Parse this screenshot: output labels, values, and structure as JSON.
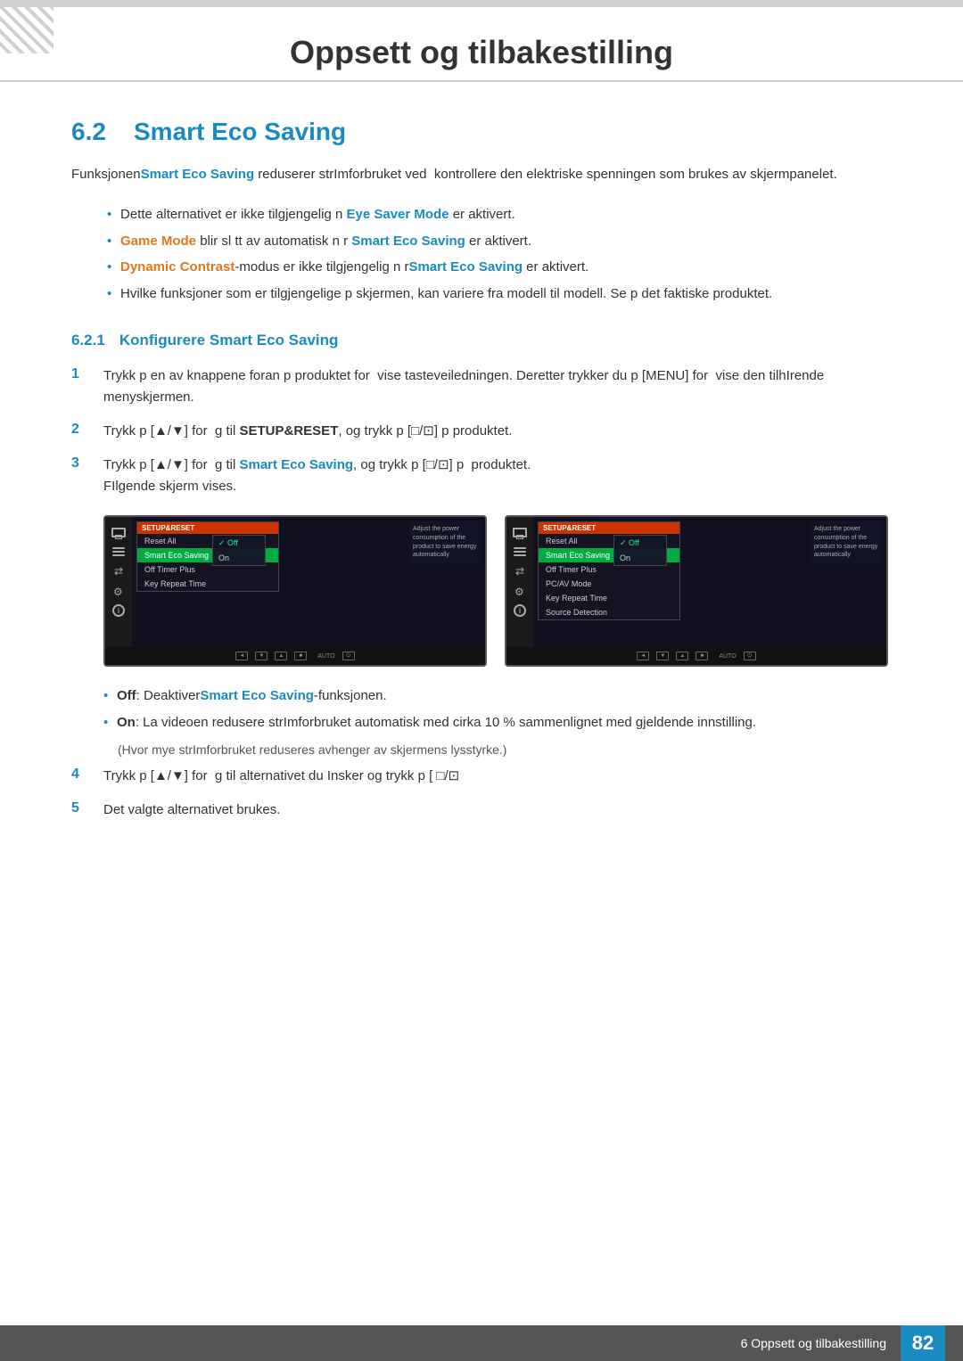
{
  "page": {
    "title": "Oppsett og tilbakestilling",
    "section_number": "6.2",
    "section_title": "Smart Eco Saving",
    "subsection_number": "6.2.1",
    "subsection_title": "Konfigurere Smart Eco Saving",
    "footer_text": "6 Oppsett og tilbakestilling",
    "footer_page": "82"
  },
  "intro_text": "FunksjonenSmart Eco Saving reduserer strImforbruket ved  kontrollere den elektriske spenningen som brukes av skjermpanelet.",
  "bullet_items": [
    {
      "text": "Dette alternativet er ikke tilgjengelig n Eye Saver Mode er aktivert.",
      "highlight": "Eye Saver Mode"
    },
    {
      "text": "Game Mode blir sl tt av automatisk n r Smart Eco Saving er aktivert.",
      "highlight1": "Game Mode",
      "highlight2": "Smart Eco Saving"
    },
    {
      "text": "Dynamic Contrast-modus er ikke tilgjengelig n rSmart Eco Saving er aktivert.",
      "highlight1": "Dynamic Contrast",
      "highlight2": "Smart Eco Saving"
    },
    {
      "text": "Hvilke funksjoner som er tilgjengelige p skjermen, kan variere fra modell til modell. Se p det faktiske produktet."
    }
  ],
  "steps": [
    {
      "number": "1",
      "text": "Trykk p en av knappene foran p produktet for  vise tasteveiledningen. Deretter trykker du p [MENU] for  vise den tilhIrende menyskjermen."
    },
    {
      "number": "2",
      "text": "Trykk p [▲/▼] for  g til SETUP&RESET, og trykk p [□/⊡] p produktet.",
      "bold": "SETUP&RESET"
    },
    {
      "number": "3",
      "text": "Trykk p [▲/▼] for  g til Smart Eco Saving, og trykk p [□/⊡] p produktet.",
      "bold": "Smart Eco Saving",
      "sub_text": "FIlgende skjerm vises."
    },
    {
      "number": "4",
      "text": "Trykk p [▲/▼] for  g til alternativet du Insker og trykk p [ □/⊡"
    },
    {
      "number": "5",
      "text": "Det valgte alternativet brukes."
    }
  ],
  "screen_left": {
    "title": "SETUP&RESET",
    "menu_items": [
      "Reset All",
      "Smart Eco Saving",
      "Off Timer Plus",
      "Key Repeat Time"
    ],
    "active_item": "Smart Eco Saving",
    "options": [
      "Off",
      "On"
    ],
    "selected_option": "Off",
    "info_text": "Adjust the power consumption of the product to save energy automatically"
  },
  "screen_right": {
    "title": "SETUP&RESET",
    "menu_items": [
      "Reset All",
      "Smart Eco Saving",
      "Off Timer Plus",
      "PC/AV Mode",
      "Key Repeat Time",
      "Source Detection"
    ],
    "active_item": "Smart Eco Saving",
    "options": [
      "Off",
      "On"
    ],
    "selected_option": "Off",
    "info_text": "Adjust the power consumption of the product to save energy automatically"
  },
  "option_descriptions": [
    {
      "label": "Off",
      "text": "Off: DeaktiverSmart Eco Saving-funksjonen.",
      "bold": "Off",
      "highlight": "Smart Eco Saving"
    },
    {
      "label": "On",
      "text": "On: La videoen redusere strImforbruket automatisk med cirka 10 % sammenlignet med gjeldende innstilling.",
      "bold": "On",
      "indent_text": "(Hvor mye strImforbruket reduseres avhenger av skjermens lysstyrke.)"
    }
  ]
}
